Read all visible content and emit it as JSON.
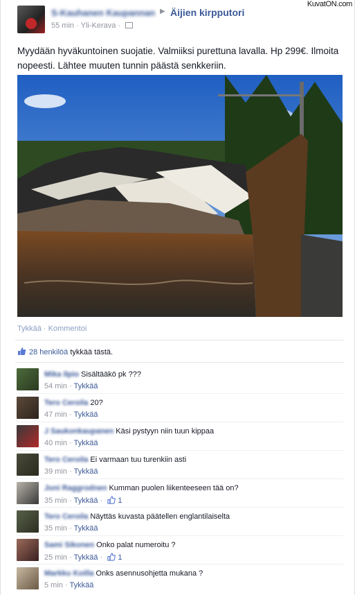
{
  "watermark": "KuvatON.com",
  "post": {
    "author": "S-Kauhanen Kaupannan",
    "group": "Äijien kirpputori",
    "time": "55 min",
    "location": "Yli-Kerava",
    "text": "Myydään hyväkuntoinen suojatie. Valmiiksi purettuna lavalla. Hp 299€. Ilmoita nopeesti. Lähtee muuten tunnin päästä senkkeriin.",
    "like_label": "Tykkää",
    "comment_label": "Kommentoi",
    "likes_count": "28 henkilöä",
    "likes_suffix": "tykkää tästä."
  },
  "comments": [
    {
      "name": "Mika Ilpio",
      "text": "Sisältääkö pk ???",
      "time": "54 min",
      "like": "Tykkää",
      "likes": ""
    },
    {
      "name": "Tero Ceroila",
      "text": "20?",
      "time": "47 min",
      "like": "Tykkää",
      "likes": ""
    },
    {
      "name": "J Saukonkaupanen",
      "text": "Käsi pystyyn niin tuun kippaa",
      "time": "40 min",
      "like": "Tykkää",
      "likes": ""
    },
    {
      "name": "Tero Ceroila",
      "text": "Ei varmaan tuu turenkiin asti",
      "time": "39 min",
      "like": "Tykkää",
      "likes": ""
    },
    {
      "name": "Joni Raggrodnen",
      "text": "Kumman puolen liikenteeseen tää on?",
      "time": "35 min",
      "like": "Tykkää",
      "likes": "1"
    },
    {
      "name": "Tero Ceroila",
      "text": "Näyttäs kuvasta päätellen englantilaiselta",
      "time": "35 min",
      "like": "Tykkää",
      "likes": ""
    },
    {
      "name": "Sami Sikonen",
      "text": "Onko palat numeroitu ?",
      "time": "25 min",
      "like": "Tykkää",
      "likes": "1"
    },
    {
      "name": "Markku Koilla",
      "text": "Onks asennusohjetta mukana ?",
      "time": "5 min",
      "like": "Tykkää",
      "likes": ""
    }
  ]
}
